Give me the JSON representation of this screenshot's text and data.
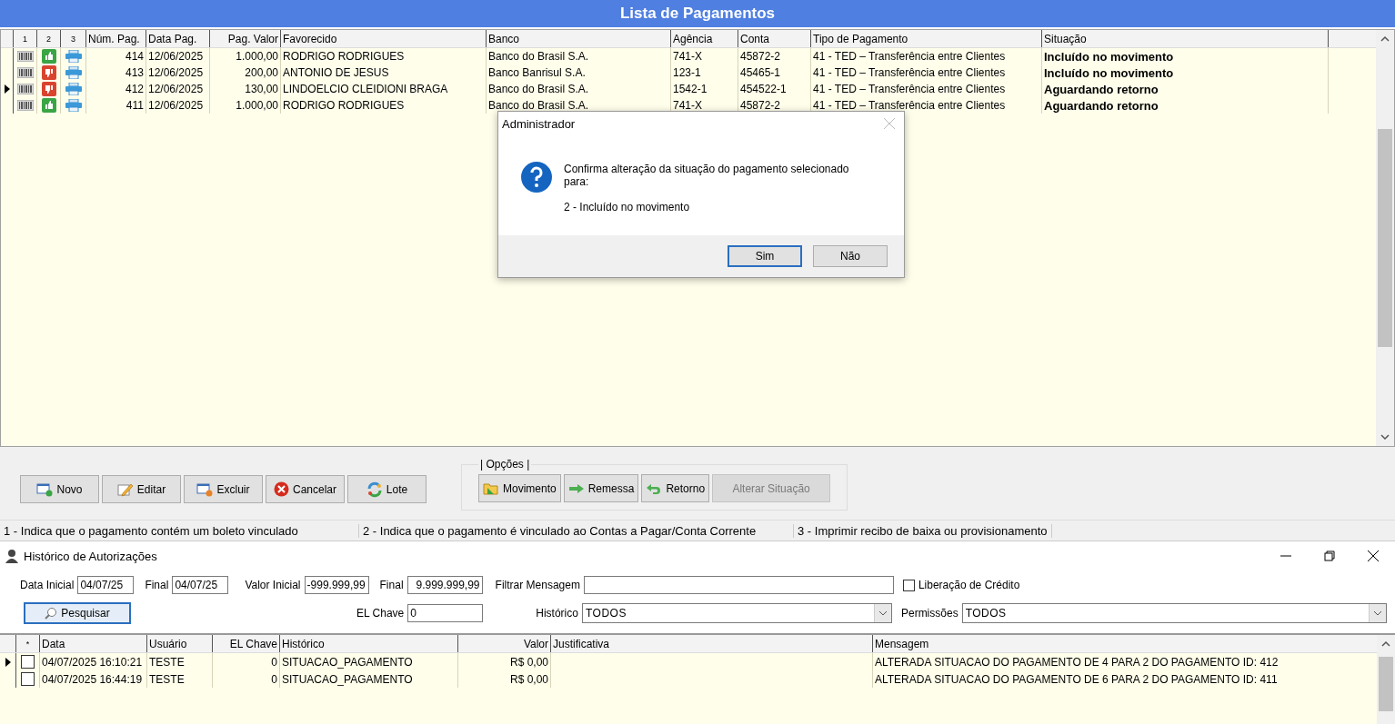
{
  "window": {
    "title": "Lista de Pagamentos"
  },
  "payments": {
    "columns": [
      "1",
      "2",
      "3",
      "Núm. Pag.",
      "Data Pag.",
      "Pag. Valor",
      "Favorecido",
      "Banco",
      "Agência",
      "Conta",
      "Tipo de Pagamento",
      "Situação"
    ],
    "rows": [
      {
        "selected": false,
        "linked": true,
        "number": "414",
        "date": "12/06/2025",
        "value": "1.000,00",
        "payee": "RODRIGO RODRIGUES",
        "bank": "Banco do Brasil S.A.",
        "agency": "741-X",
        "account": "45872-2",
        "type": "41 - TED – Transferência entre Clientes",
        "status": "Incluído no movimento"
      },
      {
        "selected": false,
        "linked": false,
        "number": "413",
        "date": "12/06/2025",
        "value": "200,00",
        "payee": "ANTONIO DE JESUS",
        "bank": "Banco Banrisul S.A.",
        "agency": "123-1",
        "account": "45465-1",
        "type": "41 - TED – Transferência entre Clientes",
        "status": "Incluído no movimento"
      },
      {
        "selected": true,
        "linked": false,
        "number": "412",
        "date": "12/06/2025",
        "value": "130,00",
        "payee": "LINDOELCIO CLEIDIONI BRAGA",
        "bank": "Banco do Brasil S.A.",
        "agency": "1542-1",
        "account": "454522-1",
        "type": "41 - TED – Transferência entre Clientes",
        "status": "Aguardando retorno"
      },
      {
        "selected": false,
        "linked": true,
        "number": "411",
        "date": "12/06/2025",
        "value": "1.000,00",
        "payee": "RODRIGO RODRIGUES",
        "bank": "Banco do Brasil S.A.",
        "agency": "741-X",
        "account": "45872-2",
        "type": "41 - TED – Transferência entre Clientes",
        "status": "Aguardando retorno"
      }
    ]
  },
  "dialog": {
    "title": "Administrador",
    "message": "Confirma alteração da situação do pagamento selecionado para:",
    "detail": "2 - Incluído no movimento",
    "buttons": [
      {
        "label": "Sim",
        "default": true
      },
      {
        "label": "Não",
        "default": false
      }
    ]
  },
  "actions": [
    {
      "label": "Novo",
      "kind": "new"
    },
    {
      "label": "Editar",
      "kind": "edit"
    },
    {
      "label": "Excluir",
      "kind": "delete"
    },
    {
      "label": "Cancelar",
      "kind": "cancel"
    },
    {
      "label": "Lote",
      "kind": "batch"
    }
  ],
  "options": {
    "title": "| Opções |",
    "buttons": [
      {
        "label": "Movimento",
        "kind": "folder",
        "disabled": false
      },
      {
        "label": "Remessa",
        "kind": "forward",
        "disabled": false
      },
      {
        "label": "Retorno",
        "kind": "return",
        "disabled": false
      },
      {
        "label": "Alterar Situação",
        "kind": "plain",
        "disabled": true
      }
    ]
  },
  "legend": [
    "1 - Indica que o pagamento contém um boleto vinculado",
    "2 - Indica que o pagamento é vinculado ao Contas a Pagar/Conta Corrente",
    "3 - Imprimir recibo de baixa ou provisionamento"
  ],
  "history": {
    "title": "Histórico de Autorizações",
    "filters": {
      "start_date_label": "Data Inicial",
      "start_date": "04/07/25",
      "end_date_label": "Final",
      "end_date": "04/07/25",
      "min_value_label": "Valor Inicial",
      "min_value": "-999.999,99",
      "max_value_label": "Final",
      "max_value": "9.999.999,99",
      "message_label": "Filtrar Mensagem",
      "credit_label": "Liberação de Crédito",
      "credit_checked": false,
      "search_button": "Pesquisar",
      "key_label": "EL Chave",
      "key": "0",
      "history_label": "Histórico",
      "history": "TODOS",
      "permissions_label": "Permissões",
      "permissions": "TODOS"
    },
    "columns": [
      "*",
      "Data",
      "Usuário",
      "EL Chave",
      "Histórico",
      "Valor",
      "Justificativa",
      "Mensagem"
    ],
    "rows": [
      {
        "selected": true,
        "checked": false,
        "date": "04/07/2025 16:10:21",
        "user": "TESTE",
        "key": "0",
        "history": "SITUACAO_PAGAMENTO",
        "value": "R$ 0,00",
        "message": "ALTERADA SITUACAO DO PAGAMENTO DE 4 PARA 2 DO PAGAMENTO ID: 412"
      },
      {
        "selected": false,
        "checked": false,
        "date": "04/07/2025 16:44:19",
        "user": "TESTE",
        "key": "0",
        "history": "SITUACAO_PAGAMENTO",
        "value": "R$ 0,00",
        "message": "ALTERADA SITUACAO DO PAGAMENTO DE 6 PARA 2 DO PAGAMENTO ID: 411"
      }
    ]
  }
}
